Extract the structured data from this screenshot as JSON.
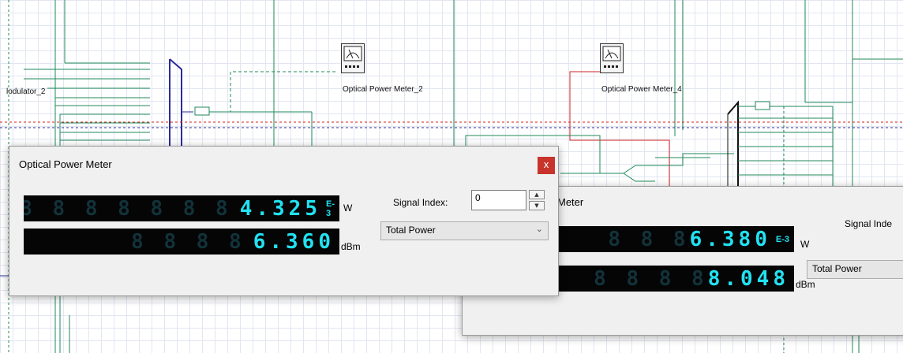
{
  "schematic": {
    "labels": {
      "modulator": "lodulator_2",
      "meter_2": "Optical Power Meter_2",
      "meter_4": "Optical Power Meter_4"
    }
  },
  "dialog_front": {
    "title": "Optical Power Meter",
    "close_glyph": "x",
    "watts": {
      "ghost": "8 8 8 8 8 8 8",
      "value": "4.325",
      "exponent": "E-3",
      "unit": "W"
    },
    "dbm": {
      "ghost": "8 8 8 8",
      "value": "6.360",
      "unit": "dBm"
    },
    "signal_index_label": "Signal Index:",
    "signal_index_value": "0",
    "mode_selected": "Total Power"
  },
  "dialog_back": {
    "title_fragment": "Meter",
    "watts": {
      "ghost": "8 8 8",
      "value": "6.380",
      "exponent": "E-3",
      "unit": "W"
    },
    "dbm": {
      "ghost": "8 8 8 8",
      "value": "8.048",
      "unit": "dBm"
    },
    "signal_index_label": "Signal Inde",
    "mode_selected": "Total Power"
  },
  "colors": {
    "wire": "#1f8a5a",
    "wire_navy": "#2b2b9a",
    "wire_red": "#d02020",
    "lcd_digit": "#21e2f2",
    "close": "#c8342b"
  }
}
